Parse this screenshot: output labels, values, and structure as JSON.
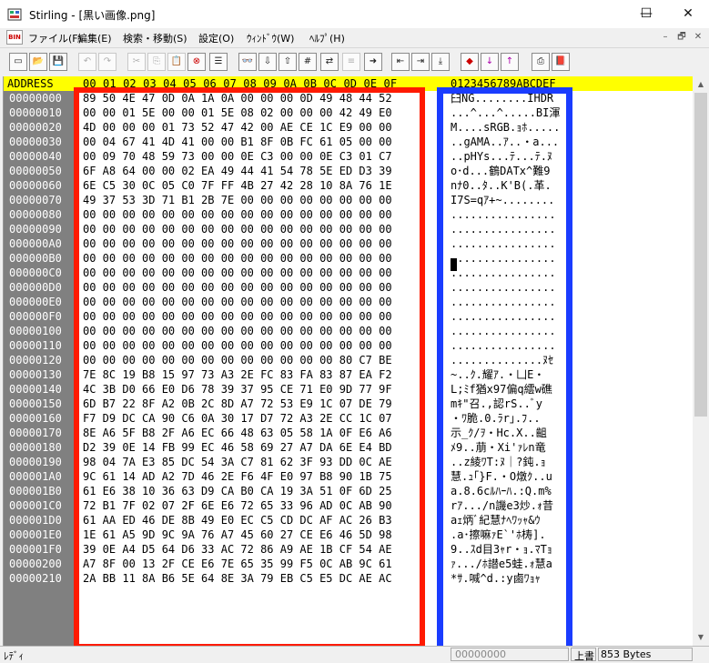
{
  "window": {
    "title": "Stirling - [黒い画像.png]",
    "controls": {
      "minimize": "—",
      "maximize": "☐",
      "close": "✕"
    }
  },
  "menu": {
    "icon_text": "BIN",
    "items": [
      "ファイル(F)",
      "編集(E)",
      "検索・移動(S)",
      "設定(O)",
      "ｳｨﾝﾄﾞｳ(W)",
      "ﾍﾙﾌﾟ(H)"
    ],
    "mdi": [
      "–",
      "🗗",
      "✕"
    ]
  },
  "toolbar": {
    "buttons": [
      "new-icon",
      "open-icon",
      "save-icon",
      "undo-icon",
      "redo-icon",
      "cut-icon",
      "copy-icon",
      "paste-icon",
      "delete-icon",
      "list-icon",
      "find-icon",
      "find-next-icon",
      "find-prev-icon",
      "find-hex-icon",
      "replace-icon",
      "compare-icon",
      "jump-icon",
      "insert-left-icon",
      "insert-right-icon",
      "insert-icon",
      "mark-icon",
      "mark-next-icon",
      "mark-prev-icon",
      "print-icon",
      "book-icon"
    ]
  },
  "editor": {
    "header_address": "ADDRESS",
    "header_columns": "00 01 02 03 04 05 06 07 08 09 0A 0B 0C 0D 0E 0F",
    "header_chars": "0123456789ABCDEF",
    "rows": [
      {
        "addr": "00000000",
        "hex": "89 50 4E 47 0D 0A 1A 0A 00 00 00 0D 49 48 44 52",
        "text": "臼NG........IHDR"
      },
      {
        "addr": "00000010",
        "hex": "00 00 01 5E 00 00 01 5E 08 02 00 00 00 42 49 E0",
        "text": "...^...^.....BI渾"
      },
      {
        "addr": "00000020",
        "hex": "4D 00 00 00 01 73 52 47 42 00 AE CE 1C E9 00 00",
        "text": "M....sRGB.ｮﾎ....."
      },
      {
        "addr": "00000030",
        "hex": "00 04 67 41 4D 41 00 00 B1 8F 0B FC 61 05 00 00",
        "text": "..gAMA..ｱ..・a..."
      },
      {
        "addr": "00000040",
        "hex": "00 09 70 48 59 73 00 00 0E C3 00 00 0E C3 01 C7",
        "text": "..pHYs...ﾃ...ﾃ.ﾇ"
      },
      {
        "addr": "00000050",
        "hex": "6F A8 64 00 00 02 EA 49 44 41 54 78 5E ED D3 39",
        "text": "o･d...鶴DATx^難9"
      },
      {
        "addr": "00000060",
        "hex": "6E C5 30 0C 05 C0 7F FF 4B 27 42 28 10 8A 76 1E",
        "text": "nﾅ0..ﾀ..K'B(.革."
      },
      {
        "addr": "00000070",
        "hex": "49 37 53 3D 71 B1 2B 7E 00 00 00 00 00 00 00 00",
        "text": "I7S=qｱ+~........"
      },
      {
        "addr": "00000080",
        "hex": "00 00 00 00 00 00 00 00 00 00 00 00 00 00 00 00",
        "text": "................"
      },
      {
        "addr": "00000090",
        "hex": "00 00 00 00 00 00 00 00 00 00 00 00 00 00 00 00",
        "text": "................"
      },
      {
        "addr": "000000A0",
        "hex": "00 00 00 00 00 00 00 00 00 00 00 00 00 00 00 00",
        "text": "................"
      },
      {
        "addr": "000000B0",
        "hex": "00 00 00 00 00 00 00 00 00 00 00 00 00 00 00 00",
        "text": "................"
      },
      {
        "addr": "000000C0",
        "hex": "00 00 00 00 00 00 00 00 00 00 00 00 00 00 00 00",
        "text": "................"
      },
      {
        "addr": "000000D0",
        "hex": "00 00 00 00 00 00 00 00 00 00 00 00 00 00 00 00",
        "text": "................"
      },
      {
        "addr": "000000E0",
        "hex": "00 00 00 00 00 00 00 00 00 00 00 00 00 00 00 00",
        "text": "................"
      },
      {
        "addr": "000000F0",
        "hex": "00 00 00 00 00 00 00 00 00 00 00 00 00 00 00 00",
        "text": "................"
      },
      {
        "addr": "00000100",
        "hex": "00 00 00 00 00 00 00 00 00 00 00 00 00 00 00 00",
        "text": "................"
      },
      {
        "addr": "00000110",
        "hex": "00 00 00 00 00 00 00 00 00 00 00 00 00 00 00 00",
        "text": "................"
      },
      {
        "addr": "00000120",
        "hex": "00 00 00 00 00 00 00 00 00 00 00 00 00 80 C7 BE",
        "text": "..............ﾇｾ"
      },
      {
        "addr": "00000130",
        "hex": "7E 8C 19 B8 15 97 73 A3 2E FC 83 FA 83 87 EA F2",
        "text": "~..ｸ.耀ｱ.・凵E・"
      },
      {
        "addr": "00000140",
        "hex": "4C 3B D0 66 E0 D6 78 39 37 95 CE 71 E0 9D 77 9F",
        "text": "L;ﾐf猶x97偏q繧w礁"
      },
      {
        "addr": "00000150",
        "hex": "6D B7 22 8F A2 0B 2C 8D A7 72 53 E9 1C 07 DE 79",
        "text": "mｷ\"召.,認rS..ﾞy"
      },
      {
        "addr": "00000160",
        "hex": "F7 D9 DC CA 90 C6 0A 30 17 D7 72 A3 2E CC 1C 07",
        "text": "・ﾜ脆.0.ﾗr｣.ﾌ.."
      },
      {
        "addr": "00000170",
        "hex": "8E A6 5F B8 2F A6 EC 66 48 63 05 58 1A 0F E6 A6",
        "text": "示_ｸ/ｦ・Hc.X..齟"
      },
      {
        "addr": "00000180",
        "hex": "D2 39 0E 14 FB 99 EC 46 58 69 27 A7 DA 6E E4 BD",
        "text": "ﾒ9..萠・Xi'ｧﾚn竜"
      },
      {
        "addr": "00000190",
        "hex": "98 04 7A E3 85 DC 54 3A C7 81 62 3F 93 DD 0C AE",
        "text": "..z綾ﾜT:ﾇ｜?鈍.ｮ"
      },
      {
        "addr": "000001A0",
        "hex": "9C 61 14 AD A2 7D 46 2E F6 4F E0 97 B8 90 1B 75",
        "text": "慧.ｭ｢}F.・O燉ｸ..u"
      },
      {
        "addr": "000001B0",
        "hex": "61 E6 38 10 36 63 D9 CA B0 CA 19 3A 51 0F 6D 25",
        "text": "a.8.6cﾙﾊｰﾊ.:Q.m%"
      },
      {
        "addr": "000001C0",
        "hex": "72 B1 7F 02 07 2F 6E E6 72 65 33 96 AD 0C AB 90",
        "text": "rｱ.../n譏e3炒.ｫ昔"
      },
      {
        "addr": "000001D0",
        "hex": "61 AA ED 46 DE 8B 49 E0 EC C5 CD DC AF AC 26 B3",
        "text": "aｪ炳ﾞ紀慧ﾅﾍﾜｯｬ&ｳ"
      },
      {
        "addr": "000001E0",
        "hex": "1E 61 A5 9D 9C 9A 76 A7 45 60 27 CE E6 46 5D 98",
        "text": ".a･擦嘛ｧE`'ﾎ梼]."
      },
      {
        "addr": "000001F0",
        "hex": "39 0E A4 D5 64 D6 33 AC 72 86 A9 AE 1B CF 54 AE",
        "text": "9..ｽd目3ｬr・ｮ.ﾏTｮ"
      },
      {
        "addr": "00000200",
        "hex": "A7 8F 00 13 2F CE E6 7E 65 35 99 F5 0C AB 9C 61",
        "text": "ｧ.../ﾎ譛e5蛙.ｫ慧a"
      },
      {
        "addr": "00000210",
        "hex": "2A BB 11 8A B6 5E 64 8E 3A 79 EB C5 E5 DC AE AC",
        "text": "*ｻ.喊^d.:y鹵ﾜｮｬ"
      }
    ]
  },
  "statusbar": {
    "left": "ﾚﾃﾞｨ",
    "address": "00000000",
    "mode": "上書",
    "size": "853 Bytes"
  }
}
